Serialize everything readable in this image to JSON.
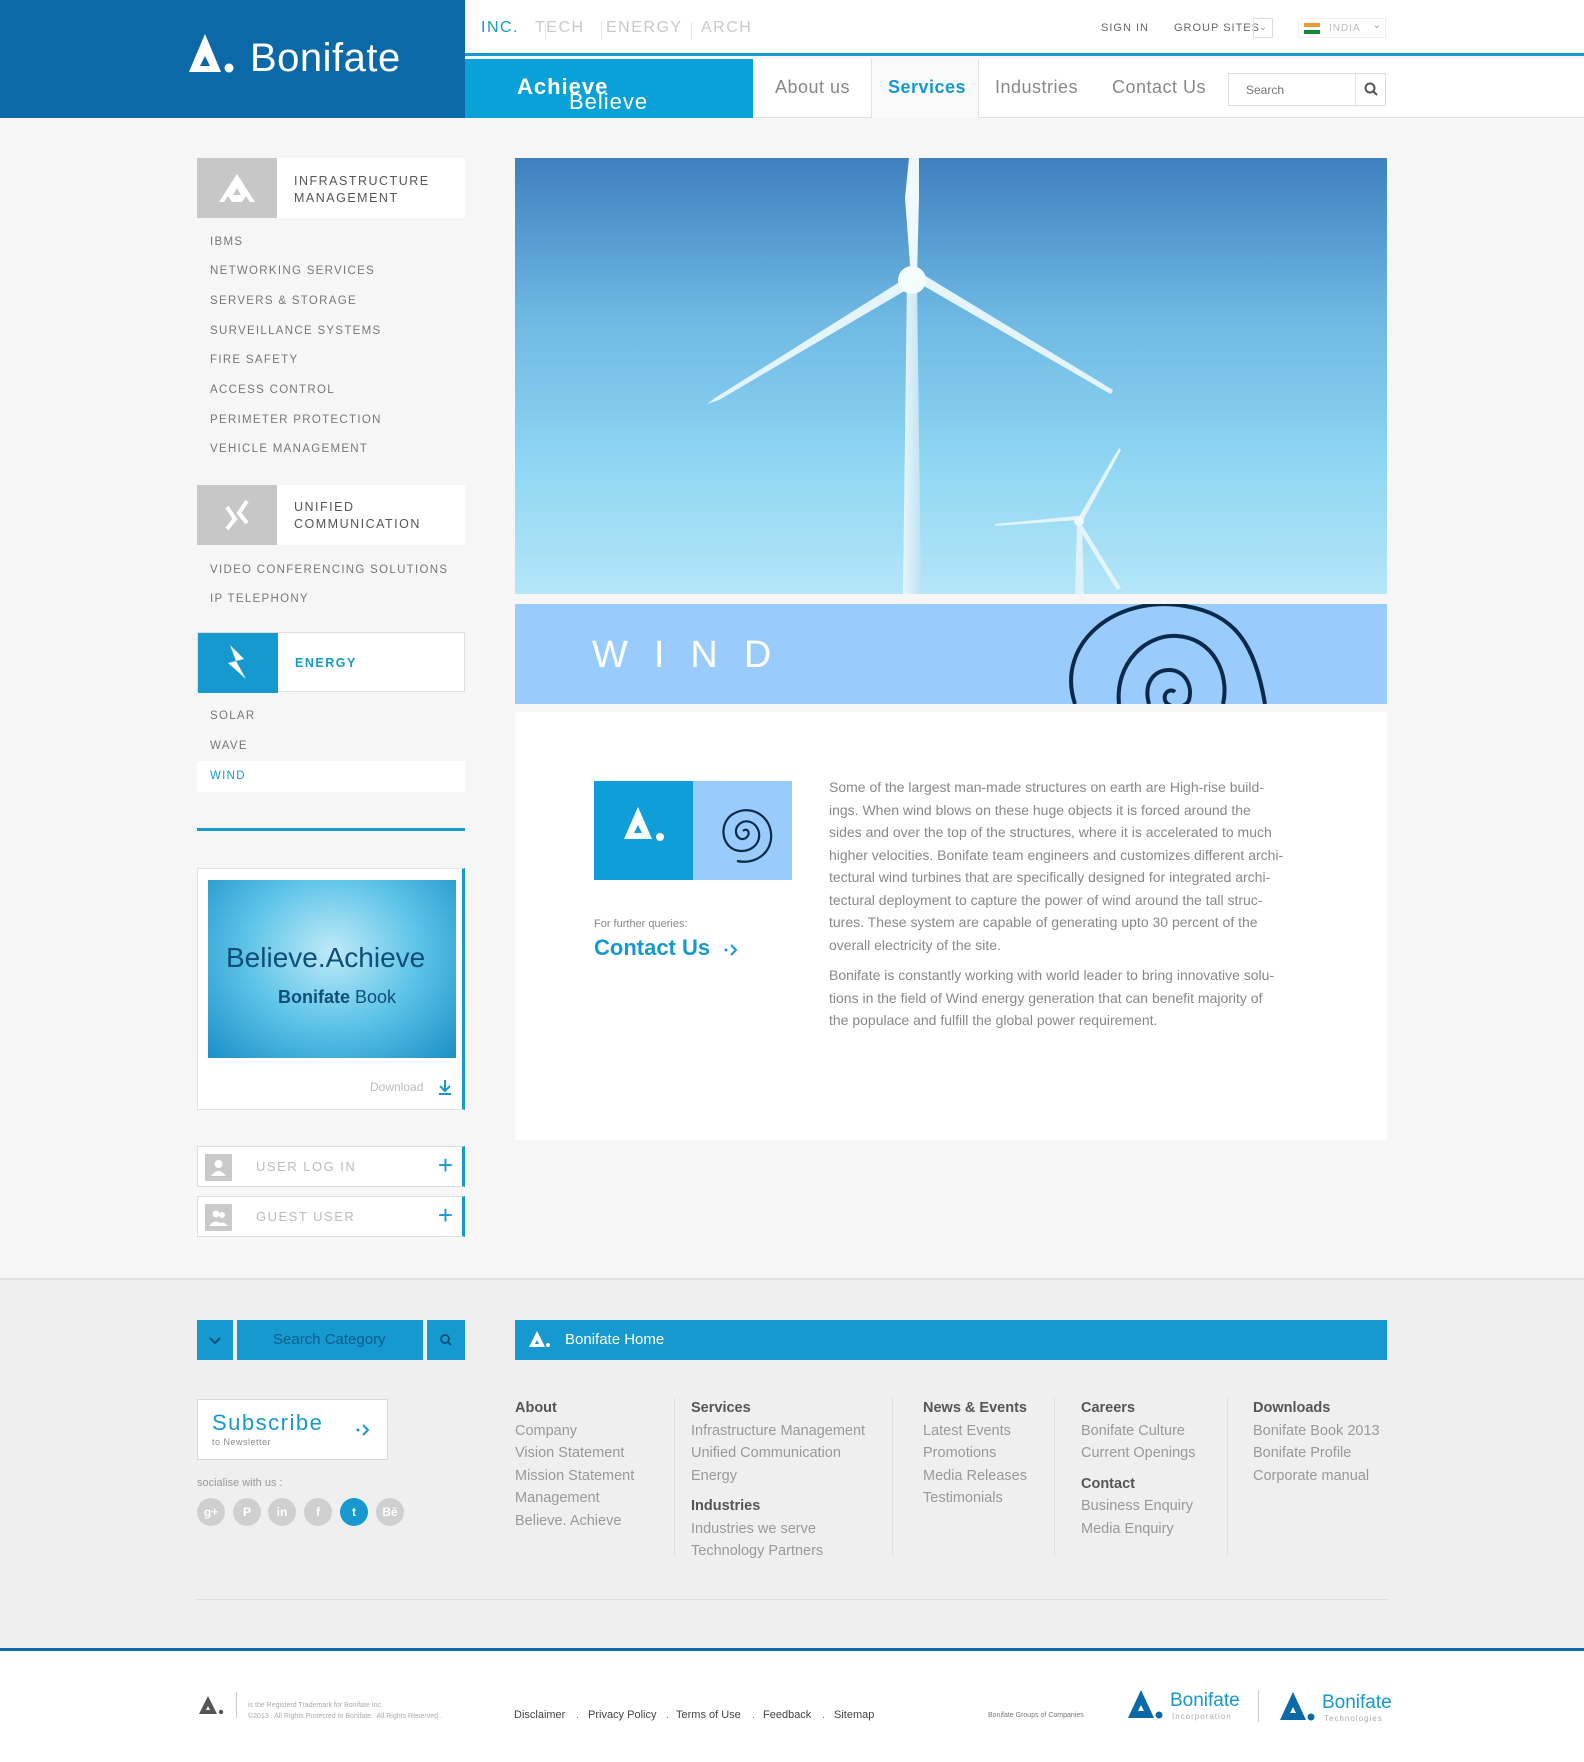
{
  "brand": {
    "name": "Bonifate"
  },
  "top_tabs": [
    "INC.",
    "TECH",
    "ENERGY",
    "ARCH"
  ],
  "top_links": {
    "sign_in": "SIGN IN",
    "group_sites": "GROUP SITES",
    "country": "INDIA"
  },
  "tagline": {
    "part1": "Believe",
    "dot": ".",
    "part2": "Achieve"
  },
  "nav": {
    "items": [
      "About us",
      "Services",
      "Industries",
      "Contact Us"
    ],
    "active": "Services"
  },
  "search": {
    "placeholder": "Search"
  },
  "sidebar": {
    "categories": [
      {
        "label_line1": "INFRASTRUCTURE",
        "label_line2": "MANAGEMENT",
        "items": [
          "IBMS",
          "NETWORKING SERVICES",
          "SERVERS & STORAGE",
          "SURVEILLANCE SYSTEMS",
          "FIRE SAFETY",
          "ACCESS CONTROL",
          "PERIMETER PROTECTION",
          "VEHICLE MANAGEMENT"
        ]
      },
      {
        "label_line1": "UNIFIED",
        "label_line2": "COMMUNICATION",
        "items": [
          "VIDEO CONFERENCING SOLUTIONS",
          "IP TELEPHONY"
        ]
      },
      {
        "label_line1": "ENERGY",
        "label_line2": "",
        "items": [
          "SOLAR",
          "WAVE",
          "WIND"
        ],
        "active": "WIND"
      }
    ],
    "book": {
      "line1": "Believe.Achieve",
      "line2_bold": "Bonifate",
      "line2_rest": "Book",
      "download": "Download"
    },
    "login": {
      "user": "USER LOG IN",
      "guest": "GUEST USER"
    }
  },
  "hero": {
    "band_title": "WIND"
  },
  "content": {
    "further_label": "For further queries:",
    "contact_link": "Contact Us",
    "paragraphs": [
      [
        "Some of the largest man-made structures on earth are High-rise build-",
        "ings. When wind blows on these huge objects it is forced around the",
        "sides and over the top of the structures, where it is accelerated to much",
        "higher velocities. Bonifate team engineers and customizes different archi-",
        "tectural wind turbines that are specifically designed for integrated archi-",
        "tectural deployment to capture the power of wind around the tall struc-",
        "tures. These system are capable of generating upto 30 percent of the",
        "overall electricity of the site."
      ],
      [
        "Bonifate is constantly working with world leader to bring innovative solu-",
        "tions in the field of Wind energy generation that can benefit majority of",
        "the populace and fulfill the global power requirement."
      ]
    ]
  },
  "footer": {
    "search_category": "Search Category",
    "home_bar": "Bonifate Home",
    "subscribe": {
      "title": "Subscribe",
      "sub": "to Newsletter"
    },
    "socialise": "socialise with us :",
    "social_icons": [
      "google-plus",
      "pinterest",
      "linkedin",
      "facebook",
      "twitter",
      "behance"
    ],
    "social_glyphs": [
      "g+",
      "P",
      "in",
      "f",
      "t",
      "Bē"
    ],
    "columns": [
      {
        "title": "About",
        "items": [
          "Company",
          "Vision Statement",
          "Mission Statement",
          "Management",
          "Believe. Achieve"
        ]
      },
      {
        "title": "Services",
        "items": [
          "Infrastructure Management",
          "Unified Communication",
          "Energy"
        ],
        "title2": "Industries",
        "items2": [
          "Industries we serve",
          "Technology Partners"
        ]
      },
      {
        "title": "News & Events",
        "items": [
          "Latest Events",
          "Promotions",
          "Media Releases",
          "Testimonials"
        ]
      },
      {
        "title": "Careers",
        "items": [
          "Bonifate Culture",
          "Current Openings"
        ],
        "title2": "Contact",
        "items2": [
          "Business Enquiry",
          "Media Enquiry"
        ]
      },
      {
        "title": "Downloads",
        "items": [
          "Bonifate Book 2013",
          "Bonifate Profile",
          "Corporate manual"
        ]
      }
    ],
    "legal_text": [
      "is the Registerd Trademark for Bonifate Inc.",
      "©2013 . All Rights Protected to Bonifate . All Rights Reserved ."
    ],
    "legal_links": [
      "Disclaimer",
      "Privacy Policy",
      "Terms of Use",
      "Feedback",
      "Sitemap"
    ],
    "group_label": "Bonifate Groups of Companies",
    "group_brands": [
      {
        "name": "Bonifate",
        "sub": "Incorporation"
      },
      {
        "name": "Bonifate",
        "sub": "Technologies"
      }
    ]
  },
  "colors": {
    "primary": "#0a69a6",
    "accent": "#1599cf",
    "wind_band": "#99ccfd"
  }
}
